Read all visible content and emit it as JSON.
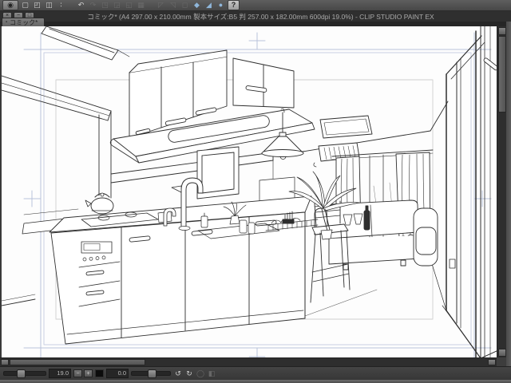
{
  "window": {
    "title": "コミック* (A4 297.00 x 210.00mm 製本サイズ:B5 判 257.00 x 182.00mm 600dpi 19.0%) - CLIP STUDIO PAINT EX",
    "controls": [
      {
        "name": "close",
        "glyph": "×"
      },
      {
        "name": "minimize",
        "glyph": "−"
      },
      {
        "name": "restore",
        "glyph": "□"
      }
    ]
  },
  "toolbar": {
    "icons": [
      {
        "name": "clip-studio-logo",
        "glyph": "◉",
        "state": "active"
      },
      {
        "name": "new-file",
        "glyph": "▢",
        "state": "normal"
      },
      {
        "name": "open-file",
        "glyph": "◰",
        "state": "normal"
      },
      {
        "name": "save-file",
        "glyph": "◫",
        "state": "normal"
      },
      {
        "name": "more-options",
        "glyph": "∶",
        "state": "normal"
      },
      {
        "name": "undo",
        "glyph": "↶",
        "state": "normal"
      },
      {
        "name": "redo",
        "glyph": "↷",
        "state": "disabled"
      },
      {
        "name": "clear",
        "glyph": "◳",
        "state": "disabled"
      },
      {
        "name": "fill",
        "glyph": "◲",
        "state": "disabled"
      },
      {
        "name": "scale-rotate",
        "glyph": "◱",
        "state": "disabled"
      },
      {
        "name": "free-transform",
        "glyph": "▦",
        "state": "disabled"
      },
      {
        "name": "snap-ruler",
        "glyph": "◸",
        "state": "disabled"
      },
      {
        "name": "snap-special-ruler",
        "glyph": "◹",
        "state": "disabled"
      },
      {
        "name": "snap-grid",
        "glyph": "◻",
        "state": "disabled"
      },
      {
        "name": "object-select",
        "glyph": "◆",
        "state": "accent"
      },
      {
        "name": "pen-cursor",
        "glyph": "◢",
        "state": "accent"
      },
      {
        "name": "anchor-pin",
        "glyph": "●",
        "state": "accent"
      },
      {
        "name": "help",
        "glyph": "?",
        "state": "light"
      }
    ]
  },
  "document_tab": {
    "label": "コミック*",
    "indicator": "▪"
  },
  "statusbar": {
    "zoom_value": "19.0",
    "rotation_value": "0.0",
    "zoom_buttons": [
      {
        "name": "zoom-out",
        "glyph": "−",
        "state": "normal"
      },
      {
        "name": "zoom-in",
        "glyph": "+",
        "state": "normal"
      }
    ],
    "rotate_buttons": [
      {
        "name": "rotate-left",
        "glyph": "↺",
        "state": "normal"
      },
      {
        "name": "rotate-right",
        "glyph": "↻",
        "state": "normal"
      },
      {
        "name": "reset-rotation",
        "glyph": "◯",
        "state": "disabled"
      },
      {
        "name": "flip-horizontal",
        "glyph": "◧",
        "state": "disabled"
      }
    ]
  },
  "colors": {
    "chrome_bg": "#4a4a4a",
    "title_bar_bg": "#2f2f2f",
    "tab_active_bg": "#767676",
    "canvas_bg": "#fdfdfd",
    "guide_blue": "#b9c2da",
    "guide_gray": "#cfcfcf",
    "line_art": "#2e2e2e"
  }
}
